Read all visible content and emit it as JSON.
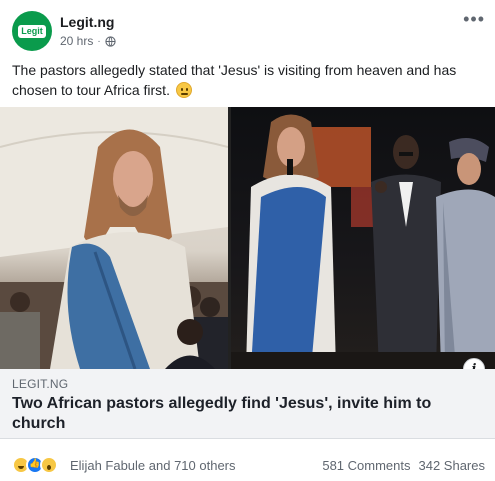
{
  "post": {
    "page_name": "Legit.ng",
    "avatar_text": "Legit",
    "timestamp": "20 hrs",
    "separator": "·",
    "privacy_icon": "globe-icon",
    "more_icon": "more-horizontal-icon",
    "caption": "The pastors allegedly stated that 'Jesus' is visiting from heaven and has chosen to tour Africa first.",
    "caption_emoji": "smile-emoji",
    "brand_color": "#0a9b4c"
  },
  "link_preview": {
    "domain": "LEGIT.NG",
    "title": "Two African pastors allegedly find 'Jesus', invite him to church",
    "info_icon": "info-icon"
  },
  "engagement": {
    "reaction_icons": [
      "haha-reaction-icon",
      "like-reaction-icon",
      "wow-reaction-icon"
    ],
    "reactors": "Elijah Fabule and 710 others",
    "comments": "581 Comments",
    "shares": "342 Shares"
  }
}
